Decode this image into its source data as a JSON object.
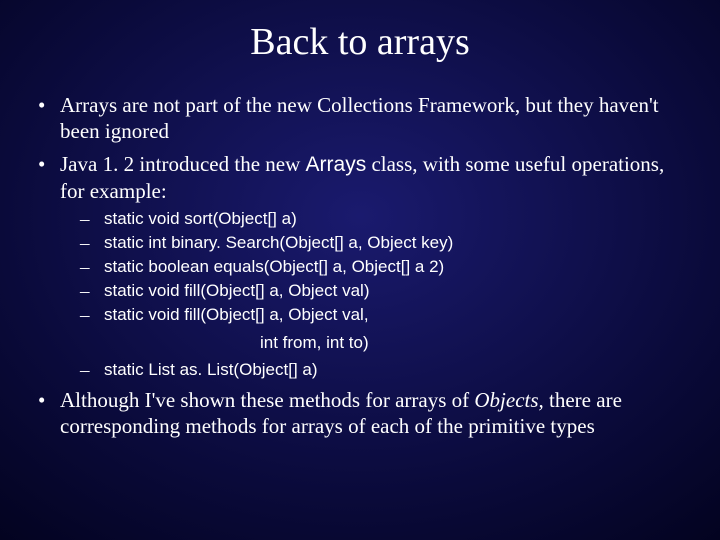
{
  "title": "Back to arrays",
  "bullets": {
    "b1": "Arrays are not part of the new Collections Framework, but they haven't been ignored",
    "b2_pre": "Java 1. 2 introduced the new ",
    "b2_code": "Arrays",
    "b2_post": " class, with some useful operations, for example:",
    "b3_pre": "Although I've shown these methods for arrays of ",
    "b3_ital": "Objects,",
    "b3_post": " there are corresponding methods for arrays of each of the primitive types"
  },
  "subs": {
    "s1": "static void sort(Object[] a)",
    "s2": "static int binary. Search(Object[] a, Object key)",
    "s3": "static boolean equals(Object[] a, Object[] a 2)",
    "s4": "static void fill(Object[] a, Object val)",
    "s5": "static void fill(Object[] a, Object val,",
    "s5b": "int from, int to)",
    "s6": "static List as. List(Object[] a)"
  }
}
